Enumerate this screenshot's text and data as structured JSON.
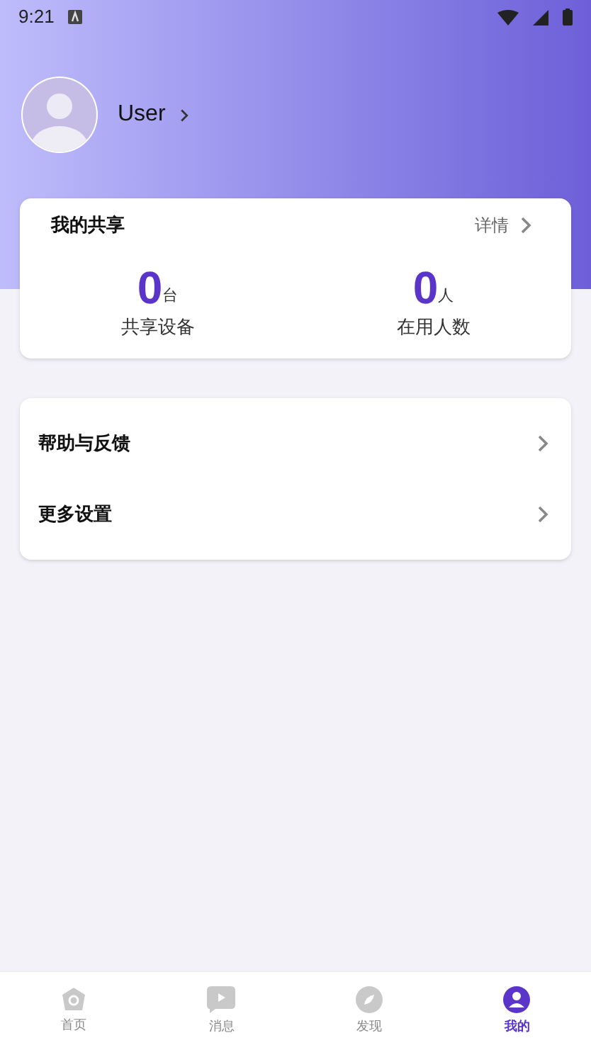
{
  "status_bar": {
    "time": "9:21"
  },
  "profile": {
    "name": "User"
  },
  "share_card": {
    "title": "我的共享",
    "detail_link": "详情",
    "stats": [
      {
        "value": "0",
        "unit": "台",
        "label": "共享设备"
      },
      {
        "value": "0",
        "unit": "人",
        "label": "在用人数"
      }
    ]
  },
  "menu": [
    {
      "label": "帮助与反馈"
    },
    {
      "label": "更多设置"
    }
  ],
  "tabs": [
    {
      "label": "首页",
      "kind": "home",
      "selected": false
    },
    {
      "label": "消息",
      "kind": "play",
      "selected": false
    },
    {
      "label": "发现",
      "kind": "compass",
      "selected": false
    },
    {
      "label": "我的",
      "kind": "person",
      "selected": true
    }
  ]
}
